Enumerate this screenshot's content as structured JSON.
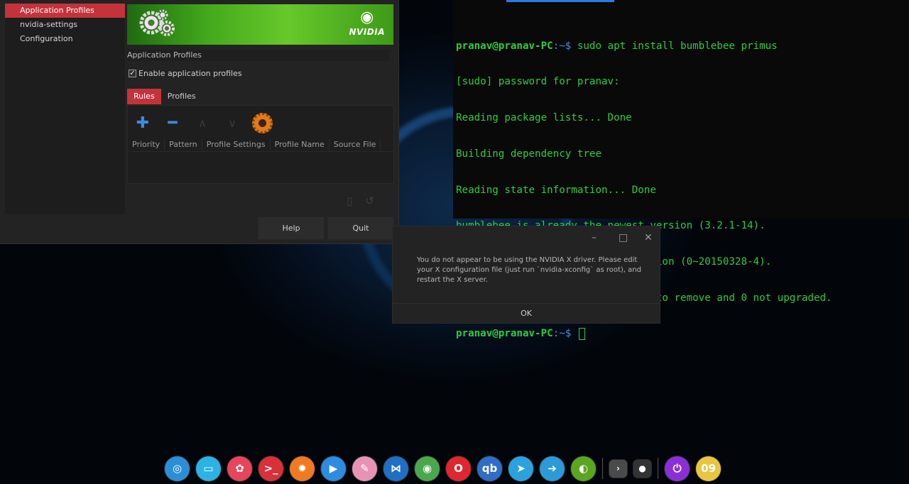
{
  "terminal": {
    "lines": [
      {
        "user": "pranav@pranav-PC",
        "path": ":~$",
        "cmd": " sudo apt install bumblebee primus"
      },
      {
        "text": "[sudo] password for pranav:"
      },
      {
        "text": "Reading package lists... Done"
      },
      {
        "text": "Building dependency tree"
      },
      {
        "text": "Reading state information... Done"
      },
      {
        "text": "bumblebee is already the newest version (3.2.1-14)."
      },
      {
        "text": "primus is already the newest version (0~20150328-4)."
      },
      {
        "text": "0 upgraded, 0 newly installed, 0 to remove and 0 not upgraded."
      },
      {
        "user": "pranav@pranav-PC",
        "path": ":~$",
        "cmd": " "
      }
    ]
  },
  "nvidia": {
    "sidebar": [
      "Application Profiles",
      "nvidia-settings Configuration"
    ],
    "logo_text": "NVIDIA",
    "section_title": "Application Profiles",
    "enable_label": "Enable application profiles",
    "tabs": [
      "Rules",
      "Profiles"
    ],
    "columns": [
      "Priority",
      "Pattern",
      "Profile Settings",
      "Profile Name",
      "Source File"
    ],
    "help_label": "Help",
    "quit_label": "Quit"
  },
  "dialog": {
    "message": "You do not appear to be using the NVIDIA X driver.  Please edit your X configuration file (just run `nvidia-xconfig` as root), and restart the X server.",
    "minimize": "–",
    "maximize": "□",
    "close": "✕",
    "ok_label": "OK"
  },
  "dock": {
    "icons": [
      {
        "name": "deepin-launcher-icon",
        "glyph": "◎",
        "color": "#2a8fd6"
      },
      {
        "name": "file-manager-icon",
        "glyph": "▭",
        "color": "#2bb3e6"
      },
      {
        "name": "app-store-icon",
        "glyph": "✿",
        "color": "#e8455a"
      },
      {
        "name": "terminal-icon",
        "glyph": ">_",
        "color": "#d9303a"
      },
      {
        "name": "settings-icon",
        "glyph": "✹",
        "color": "#f07a22"
      },
      {
        "name": "media-player-icon",
        "glyph": "▶",
        "color": "#2d8be0"
      },
      {
        "name": "drawing-icon",
        "glyph": "✎",
        "color": "#e892b5"
      },
      {
        "name": "vscode-icon",
        "glyph": "⋈",
        "color": "#1f6fc4"
      },
      {
        "name": "chrome-icon",
        "glyph": "◉",
        "color": "#4aa84c"
      },
      {
        "name": "opera-icon",
        "glyph": "O",
        "color": "#e0262f"
      },
      {
        "name": "torrent-icon",
        "glyph": "qb",
        "color": "#2f6dc7"
      },
      {
        "name": "telegram-icon",
        "glyph": "➤",
        "color": "#2ba2de"
      },
      {
        "name": "transfer-icon",
        "glyph": "➔",
        "color": "#2a9bd8"
      },
      {
        "name": "nvidia-icon",
        "glyph": "◐",
        "color": "#5aa61f"
      }
    ],
    "tray": [
      {
        "name": "tray-expand-icon",
        "glyph": "›",
        "color": "#4a4a4a"
      },
      {
        "name": "tray-record-icon",
        "glyph": "●",
        "color": "#333"
      }
    ],
    "extra": [
      {
        "name": "power-icon",
        "glyph": "⏻",
        "color": "#8a2fd8"
      },
      {
        "name": "clock-icon",
        "glyph": "09",
        "color": "#e9c640"
      }
    ]
  }
}
